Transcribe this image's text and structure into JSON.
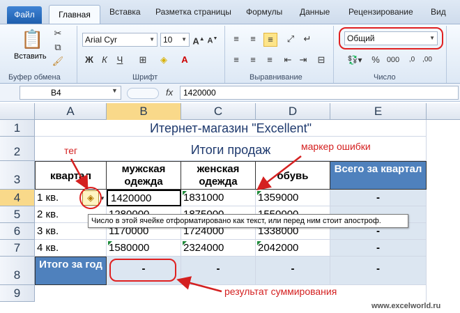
{
  "ribbon_tabs": [
    "Файл",
    "Главная",
    "Вставка",
    "Разметка страницы",
    "Формулы",
    "Данные",
    "Рецензирование",
    "Вид"
  ],
  "ribbon": {
    "paste_label": "Вставить",
    "font_name": "Arial Cyr",
    "font_size": "10",
    "number_format": "Общий",
    "groups": {
      "clipboard": "Буфер обмена",
      "font": "Шрифт",
      "alignment": "Выравнивание",
      "number": "Число"
    }
  },
  "formula_bar": {
    "name_box": "B4",
    "fx": "fx",
    "value": "1420000"
  },
  "columns": [
    "A",
    "B",
    "C",
    "D",
    "E"
  ],
  "rows": [
    "1",
    "2",
    "3",
    "4",
    "5",
    "6",
    "7",
    "8",
    "9"
  ],
  "sheet": {
    "title": "Итернет-магазин \"Excellent\"",
    "subtitle": "Итоги продаж",
    "headers": {
      "a": "квартал",
      "b": "мужская одежда",
      "c": "женская одежда",
      "d": "обувь",
      "e": "Всего за квартал"
    },
    "data": [
      {
        "q": "1 кв.",
        "b": "1420000",
        "c": "1831000",
        "d": "1359000",
        "e": "-"
      },
      {
        "q": "2 кв.",
        "b": "1280000",
        "c": "1875000",
        "d": "1550000",
        "e": "-"
      },
      {
        "q": "3 кв.",
        "b": "1170000",
        "c": "1724000",
        "d": "1338000",
        "e": "-"
      },
      {
        "q": "4 кв.",
        "b": "1580000",
        "c": "2324000",
        "d": "2042000",
        "e": "-"
      }
    ],
    "total": {
      "label": "Итого за год",
      "b": "-",
      "c": "-",
      "d": "-",
      "e": "-"
    }
  },
  "tooltip": "Число в этой ячейке отформатировано как текст, или перед ним стоит апостроф.",
  "annotations": {
    "tag": "тег",
    "error_marker": "маркер ошибки",
    "sum_result": "результат суммирования"
  },
  "watermark": "www.excelworld.ru",
  "colors": {
    "accent_blue": "#4f81bd",
    "light_blue": "#dce6f1",
    "annotation_red": "#d42020",
    "error_triangle": "#1e8a3a"
  }
}
